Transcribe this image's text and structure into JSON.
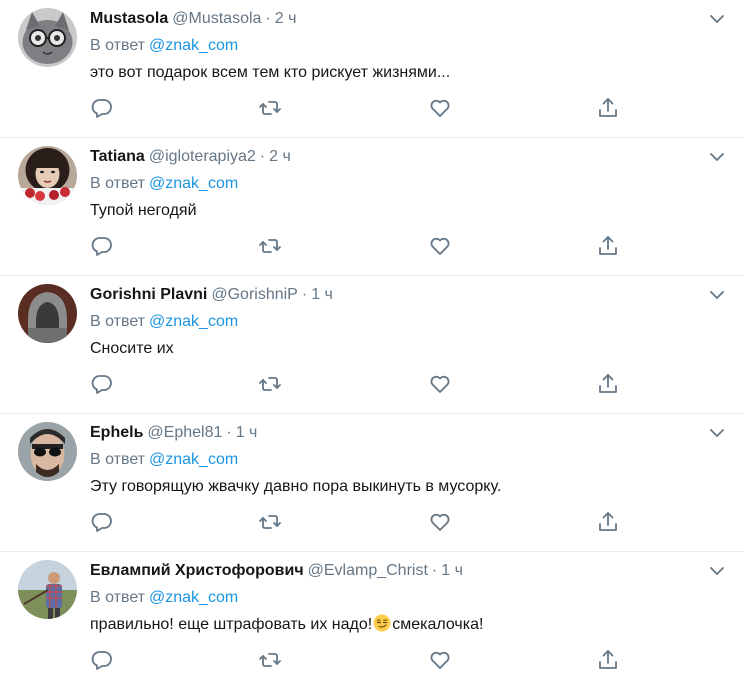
{
  "tweets": [
    {
      "name": "Mustasola",
      "handle": "@Mustasola",
      "time": "2 ч",
      "reply_prefix": "В ответ",
      "reply_to": "@znak_com",
      "text": "это вот подарок всем тем кто рискует жизнями...",
      "avatar": "cat-with-glasses"
    },
    {
      "name": "Tatiana",
      "handle": "@igloterapiya2",
      "time": "2 ч",
      "reply_prefix": "В ответ",
      "reply_to": "@znak_com",
      "text": "Тупой негодяй",
      "avatar": "woman-with-flowers"
    },
    {
      "name": "Gorishni Plavni",
      "handle": "@GorishniP",
      "time": "1 ч",
      "reply_prefix": "В ответ",
      "reply_to": "@znak_com",
      "text": "Сносите их",
      "avatar": "hooded-figure"
    },
    {
      "name": "Ephelь",
      "handle": "@Ephel81",
      "time": "1 ч",
      "reply_prefix": "В ответ",
      "reply_to": "@znak_com",
      "text": "Эту говорящую жвачку давно пора выкинуть в мусорку.",
      "avatar": "man-with-sunglasses"
    },
    {
      "name": "Евлампий Христофорович",
      "handle": "@Evlamp_Christ",
      "time": "1 ч",
      "reply_prefix": "В ответ",
      "reply_to": "@znak_com",
      "text_before_emoji": "правильно! еще штрафовать их надо!",
      "text_after_emoji": "смекалочка!",
      "emoji": "smirking-face",
      "avatar": "man-in-field"
    }
  ],
  "icons": {
    "reply": "reply-icon",
    "retweet": "retweet-icon",
    "like": "like-icon",
    "share": "share-icon",
    "more": "chevron-down-icon"
  },
  "colors": {
    "text": "#14171a",
    "secondary": "#657786",
    "link": "#1b95e0",
    "divider": "#e6ecf0"
  }
}
